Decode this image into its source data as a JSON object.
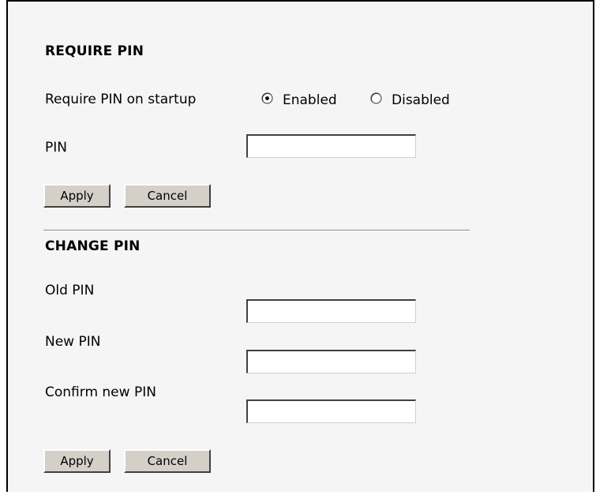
{
  "require_pin": {
    "title": "REQUIRE PIN",
    "startup_label": "Require PIN on startup",
    "options": [
      "Enabled",
      "Disabled"
    ],
    "selected": "Enabled",
    "pin_label": "PIN",
    "pin_value": "",
    "apply_label": "Apply",
    "cancel_label": "Cancel"
  },
  "change_pin": {
    "title": "CHANGE PIN",
    "old_pin_label": "Old PIN",
    "old_pin_value": "",
    "new_pin_label": "New PIN",
    "new_pin_value": "",
    "confirm_pin_label": "Confirm new PIN",
    "confirm_pin_value": "",
    "apply_label": "Apply",
    "cancel_label": "Cancel"
  }
}
